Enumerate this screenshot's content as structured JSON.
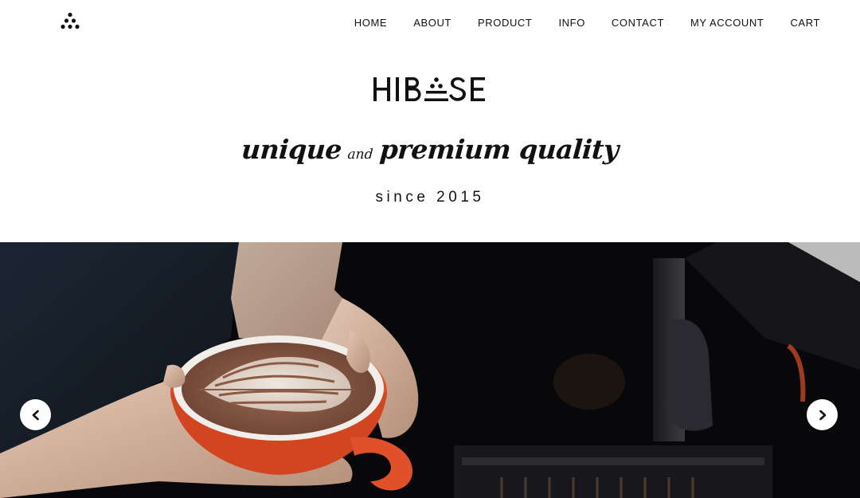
{
  "header": {
    "logo_icon": "dots-triangle-logo-icon",
    "nav": [
      {
        "label": "HOME"
      },
      {
        "label": "ABOUT"
      },
      {
        "label": "PRODUCT"
      },
      {
        "label": "INFO"
      },
      {
        "label": "CONTACT"
      },
      {
        "label": "MY ACCOUNT"
      },
      {
        "label": "CART"
      }
    ]
  },
  "brand": {
    "name": "HIBASE",
    "tagline_part1": "unique",
    "tagline_and": "and",
    "tagline_part2": "premium quality",
    "since": "since 2015"
  },
  "slider": {
    "prev_icon": "chevron-left-icon",
    "next_icon": "chevron-right-icon"
  },
  "colors": {
    "cup": "#e0502a",
    "hero_bg": "#0a0a0c"
  }
}
